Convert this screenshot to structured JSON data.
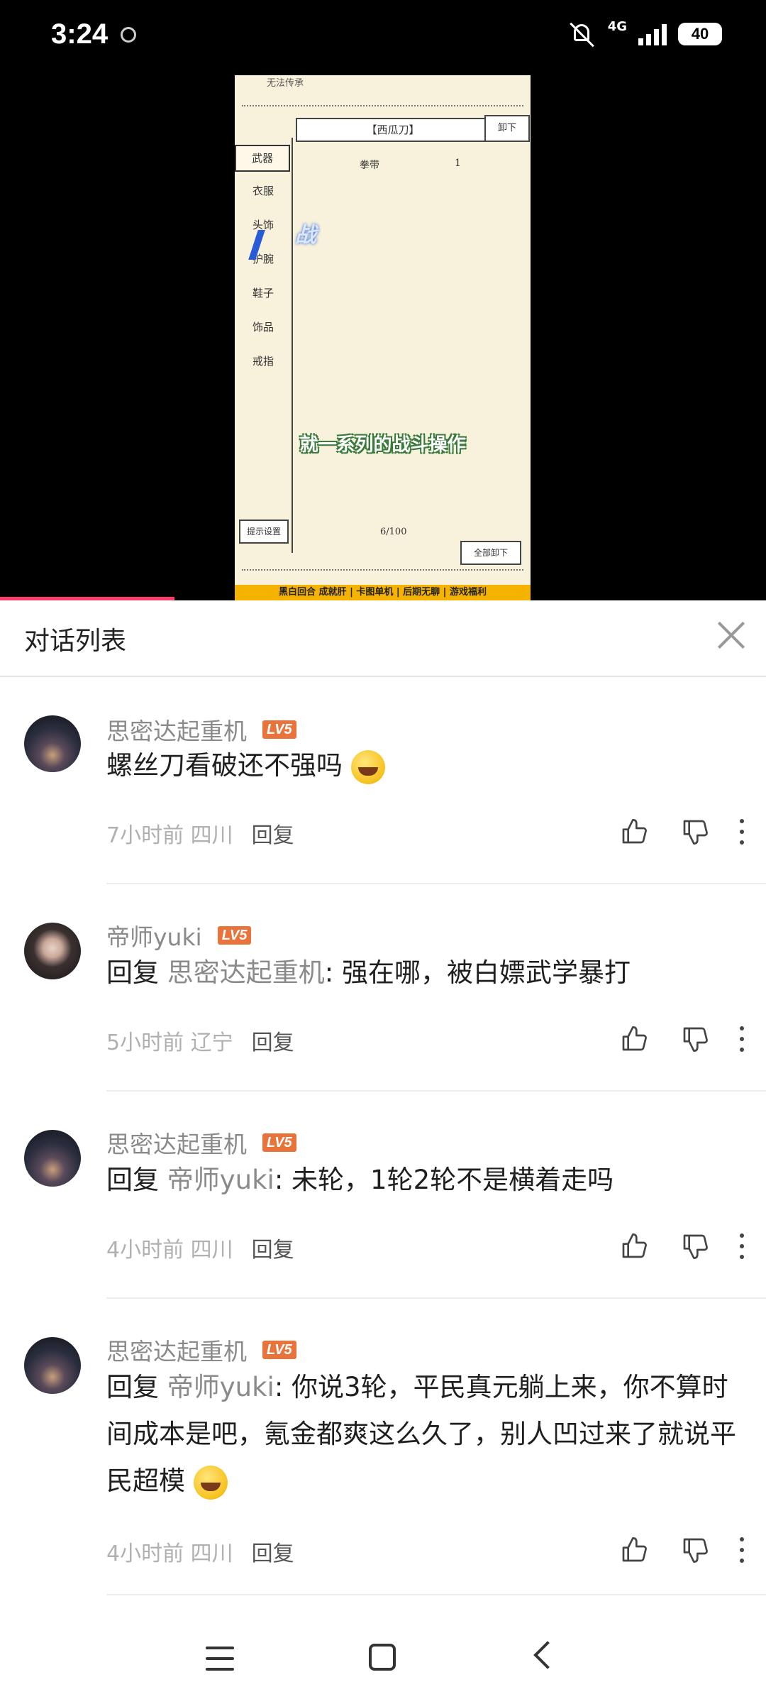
{
  "status_bar": {
    "time": "3:24",
    "network": "4G",
    "battery": "40"
  },
  "video": {
    "top_text": "无法传承",
    "selected_slot": "【西瓜刀】",
    "unequip_label": "卸下",
    "sidebar": [
      "武器",
      "衣服",
      "头饰",
      "护腕",
      "鞋子",
      "饰品",
      "戒指"
    ],
    "item_name": "拳带",
    "item_count": "1",
    "battle_fx": "战",
    "subtitle": "就一系列的战斗操作",
    "hint_button": "提示设置",
    "counter": "6/100",
    "unequip_all": "全部卸下",
    "banner": "黑白回合 成就肝 | 卡图单机 | 后期无聊 | 游戏福利"
  },
  "sheet": {
    "title": "对话列表"
  },
  "comments": [
    {
      "user": "思密达起重机",
      "level": "LV5",
      "text": "螺丝刀看破还不强吗",
      "time": "7小时前",
      "location": "四川",
      "reply_label": "回复",
      "has_emoji": true
    },
    {
      "user": "帝师yuki",
      "level": "LV5",
      "reply_prefix": "回复",
      "mention": "思密达起重机",
      "text": ": 强在哪，被白嫖武学暴打",
      "time": "5小时前",
      "location": "辽宁",
      "reply_label": "回复"
    },
    {
      "user": "思密达起重机",
      "level": "LV5",
      "reply_prefix": "回复",
      "mention": "帝师yuki",
      "text": ": 未轮，1轮2轮不是横着走吗",
      "time": "4小时前",
      "location": "四川",
      "reply_label": "回复"
    },
    {
      "user": "思密达起重机",
      "level": "LV5",
      "reply_prefix": "回复",
      "mention": "帝师yuki",
      "text": ": 你说3轮，平民真元躺上来，你不算时间成本是吧，氪金都爽这么久了，别人凹过来了就说平民超模",
      "time": "4小时前",
      "location": "四川",
      "reply_label": "回复",
      "has_emoji": true
    }
  ],
  "colors": {
    "level_badge": "#e8743b",
    "progress": "#ff3b6b",
    "banner": "#f5b300"
  }
}
